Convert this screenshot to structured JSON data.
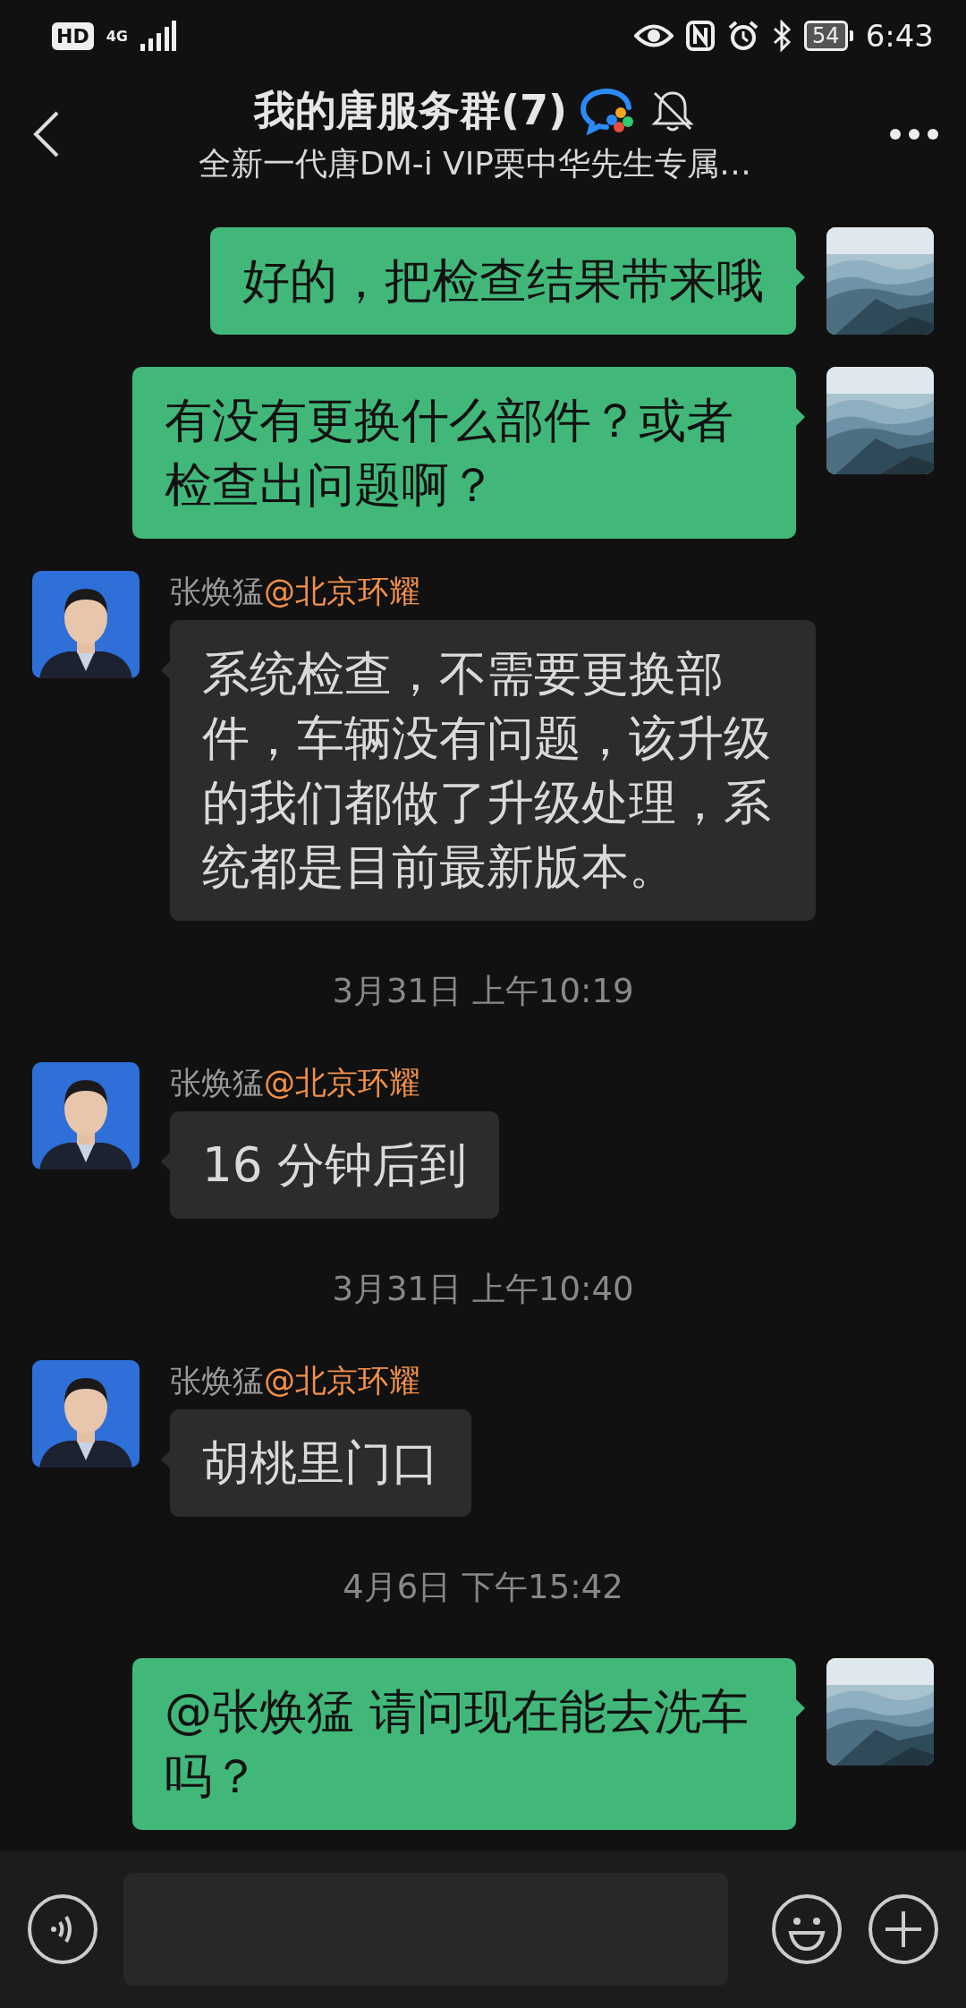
{
  "status_bar": {
    "network_badge": "HD",
    "network_type": "4G",
    "battery": "54",
    "time": "6:43"
  },
  "header": {
    "title": "我的唐服务群(7)",
    "muted": true,
    "subtitle": "全新一代唐DM-i VIP栗中华先生专属…"
  },
  "messages": [
    {
      "kind": "sent",
      "text": "好的，把检查结果带来哦"
    },
    {
      "kind": "sent",
      "text": "有没有更换什么部件？或者检查出问题啊？"
    },
    {
      "kind": "received",
      "sender": "张焕猛",
      "sender_org": "@北京环耀",
      "text": "系统检查，不需要更换部件，车辆没有问题，该升级的我们都做了升级处理，系统都是目前最新版本。"
    },
    {
      "kind": "time",
      "text": "3月31日 上午10:19"
    },
    {
      "kind": "received",
      "sender": "张焕猛",
      "sender_org": "@北京环耀",
      "text": "16 分钟后到"
    },
    {
      "kind": "time",
      "text": "3月31日 上午10:40"
    },
    {
      "kind": "received",
      "sender": "张焕猛",
      "sender_org": "@北京环耀",
      "text": "胡桃里门口"
    },
    {
      "kind": "time",
      "text": "4月6日 下午15:42"
    },
    {
      "kind": "sent",
      "text": "@张焕猛  请问现在能去洗车吗？"
    }
  ]
}
